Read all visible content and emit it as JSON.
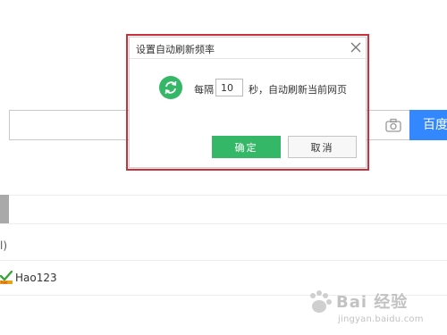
{
  "page": {
    "search": {
      "value": "",
      "button_label": "百度"
    },
    "list_item_text": "l)",
    "hao_link_label": "Hao123"
  },
  "dialog": {
    "title": "设置自动刷新频率",
    "interval_prefix": "每隔",
    "interval_value": "10",
    "interval_suffix": "秒，自动刷新当前网页",
    "ok_label": "确定",
    "cancel_label": "取消"
  },
  "watermark": {
    "brand": "Bai 经验",
    "url": "jingyan.baidu.com"
  },
  "colors": {
    "highlight_border": "#c8323c",
    "ok_button": "#35b768",
    "search_button": "#3388ff",
    "refresh_icon": "#35b768"
  },
  "icons": [
    "camera-icon",
    "close-icon",
    "refresh-icon",
    "hao123-logo",
    "baidu-paw-icon"
  ]
}
